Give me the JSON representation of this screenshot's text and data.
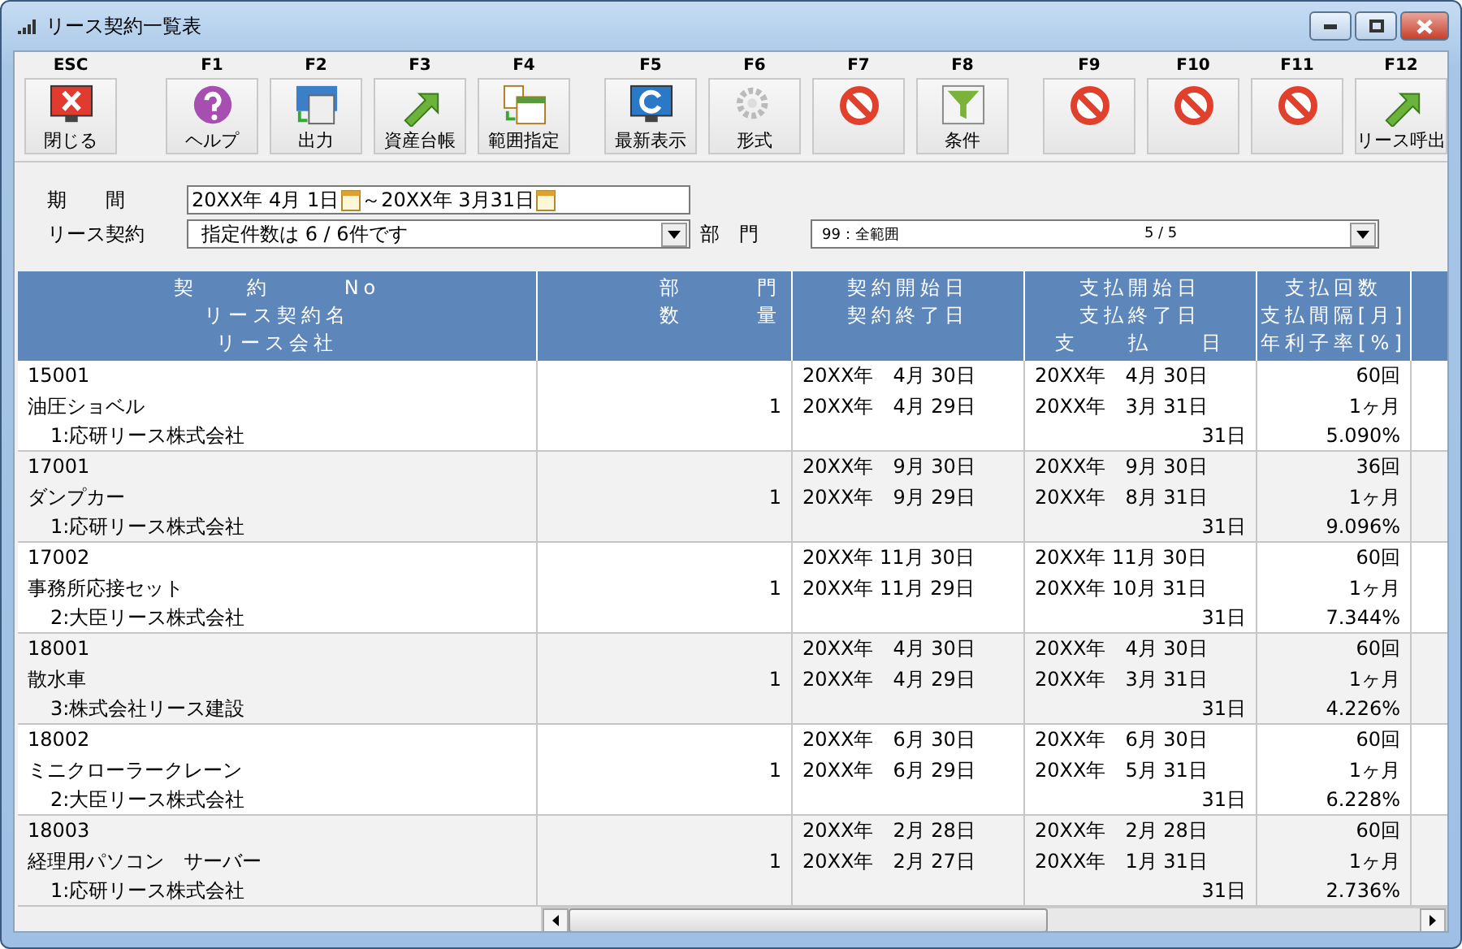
{
  "window": {
    "title": "リース契約一覧表"
  },
  "toolbar": {
    "groups": [
      [
        {
          "key": "ESC",
          "label": "閉じる",
          "kind": "close"
        }
      ],
      [
        {
          "key": "F1",
          "label": "ヘルプ",
          "kind": "help"
        },
        {
          "key": "F2",
          "label": "出力",
          "kind": "print"
        },
        {
          "key": "F3",
          "label": "資産台帳",
          "kind": "arrow"
        },
        {
          "key": "F4",
          "label": "範囲指定",
          "kind": "calendar"
        }
      ],
      [
        {
          "key": "F5",
          "label": "最新表示",
          "kind": "refresh"
        },
        {
          "key": "F6",
          "label": "形式",
          "kind": "gear"
        },
        {
          "key": "F7",
          "kind": "forbidden"
        },
        {
          "key": "F8",
          "label": "条件",
          "kind": "filter"
        }
      ],
      [
        {
          "key": "F9",
          "kind": "forbidden"
        },
        {
          "key": "F10",
          "kind": "forbidden"
        },
        {
          "key": "F11",
          "kind": "forbidden"
        },
        {
          "key": "F12",
          "label": "リース呼出",
          "kind": "arrow"
        }
      ]
    ]
  },
  "filters": {
    "period_label": "期　　間",
    "period_from": "20XX年 4月 1日",
    "period_to": "～20XX年 3月31日",
    "contract_label": "リース契約",
    "contract_value": "指定件数は 6 / 6件です",
    "department_label": "部　門",
    "department_value": "99：全範囲",
    "department_count": "5 / 5"
  },
  "table": {
    "columns": [
      {
        "lines": [
          "契　　約　　　No",
          "リース契約名",
          "リース会社"
        ]
      },
      {
        "lines": [
          "部　　　門",
          "数　　　量"
        ]
      },
      {
        "lines": [
          "契約開始日",
          "契約終了日"
        ]
      },
      {
        "lines": [
          "支払開始日",
          "支払終了日",
          "支　　払　　日"
        ]
      },
      {
        "lines": [
          "支払回数",
          "支払間隔[月]",
          "年利子率[%]"
        ]
      }
    ],
    "rows": [
      {
        "no": "15001",
        "name": "油圧ショベル",
        "company": "1:応研リース株式会社",
        "quantity": "1",
        "contract_start": "20XX年　4月 30日",
        "contract_end": "20XX年　4月 29日",
        "pay_start": "20XX年　4月 30日",
        "pay_end": "20XX年　3月 31日",
        "pay_day": "31日",
        "count": "60回",
        "interval": "1ヶ月",
        "rate": "5.090%"
      },
      {
        "no": "17001",
        "name": "ダンプカー",
        "company": "1:応研リース株式会社",
        "quantity": "1",
        "contract_start": "20XX年　9月 30日",
        "contract_end": "20XX年　9月 29日",
        "pay_start": "20XX年　9月 30日",
        "pay_end": "20XX年　8月 31日",
        "pay_day": "31日",
        "count": "36回",
        "interval": "1ヶ月",
        "rate": "9.096%"
      },
      {
        "no": "17002",
        "name": "事務所応接セット",
        "company": "2:大臣リース株式会社",
        "quantity": "1",
        "contract_start": "20XX年 11月 30日",
        "contract_end": "20XX年 11月 29日",
        "pay_start": "20XX年 11月 30日",
        "pay_end": "20XX年 10月 31日",
        "pay_day": "31日",
        "count": "60回",
        "interval": "1ヶ月",
        "rate": "7.344%"
      },
      {
        "no": "18001",
        "name": "散水車",
        "company": "3:株式会社リース建設",
        "quantity": "1",
        "contract_start": "20XX年　4月 30日",
        "contract_end": "20XX年　4月 29日",
        "pay_start": "20XX年　4月 30日",
        "pay_end": "20XX年　3月 31日",
        "pay_day": "31日",
        "count": "60回",
        "interval": "1ヶ月",
        "rate": "4.226%"
      },
      {
        "no": "18002",
        "name": "ミニクローラークレーン",
        "company": "2:大臣リース株式会社",
        "quantity": "1",
        "contract_start": "20XX年　6月 30日",
        "contract_end": "20XX年　6月 29日",
        "pay_start": "20XX年　6月 30日",
        "pay_end": "20XX年　5月 31日",
        "pay_day": "31日",
        "count": "60回",
        "interval": "1ヶ月",
        "rate": "6.228%"
      },
      {
        "no": "18003",
        "name": "経理用パソコン　サーバー",
        "company": "1:応研リース株式会社",
        "quantity": "1",
        "contract_start": "20XX年　2月 28日",
        "contract_end": "20XX年　2月 27日",
        "pay_start": "20XX年　2月 28日",
        "pay_end": "20XX年　1月 31日",
        "pay_day": "31日",
        "count": "60回",
        "interval": "1ヶ月",
        "rate": "2.736%"
      }
    ]
  }
}
